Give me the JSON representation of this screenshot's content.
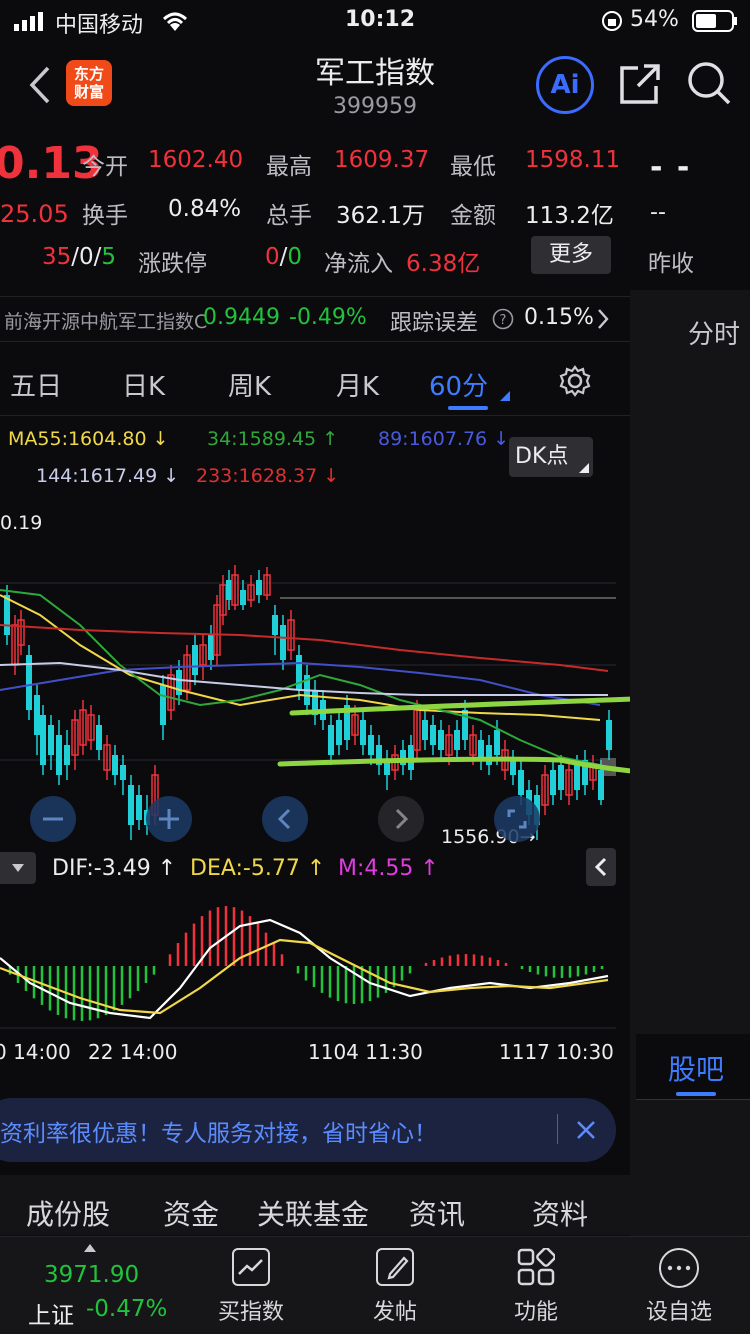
{
  "status_bar": {
    "carrier": "中国移动",
    "time": "10:12",
    "battery": "54%"
  },
  "header": {
    "title": "军工指数",
    "code": "399959",
    "logo_text": "东方\n财富",
    "ai_label": "Ai"
  },
  "quote": {
    "price": "0.13",
    "change": "25.05",
    "open_label": "今开",
    "open": "1602.40",
    "high_label": "最高",
    "high": "1609.37",
    "low_label": "最低",
    "low": "1598.11",
    "dash_1": "- -",
    "turnover_label": "换手",
    "turnover": "0.84%",
    "volume_label": "总手",
    "volume": "362.1万",
    "amount_label": "金额",
    "amount": "113.2亿",
    "dash_2": "--",
    "updown_up": "35",
    "updown_sep1": "/",
    "updown_flat": "0",
    "updown_sep2": "/",
    "updown_down": "5",
    "limit_label": "涨跌停",
    "limit_up": "0",
    "limit_sep": "/",
    "limit_down": "0",
    "netflow_label": "净流入",
    "netflow": "6.38亿",
    "more_label": "更多",
    "prev_close_label": "昨收"
  },
  "fund_bar": {
    "name": "前海开源中航军工指数C",
    "price": "0.9449",
    "change": "-0.49%",
    "tracking_label": "跟踪误差",
    "tracking_value": "0.15%"
  },
  "right_panel": {
    "intraday_tab": "分时",
    "guba_tab": "股吧"
  },
  "period_tabs": [
    {
      "label": "五日",
      "active": false
    },
    {
      "label": "日K",
      "active": false
    },
    {
      "label": "周K",
      "active": false
    },
    {
      "label": "月K",
      "active": false
    },
    {
      "label": "60分",
      "active": true
    }
  ],
  "ma": {
    "ma55": "MA55:1604.80 ↓",
    "ma34": "34:1589.45 ↑",
    "ma89": "89:1607.76 ↓",
    "ma144": "144:1617.49 ↓",
    "ma233": "233:1628.37 ↓",
    "dk_label": "DK点"
  },
  "chart": {
    "top_price_label": "0.19",
    "low_marker": "1556.90→",
    "colors": {
      "up": "#f0323c",
      "down": "#1fd0d8",
      "ma55": "#f0d84a",
      "ma34": "#2ea83a",
      "ma89": "#4150c8",
      "ma144": "#c8cce8",
      "ma233": "#c82a2a",
      "annotation": "#8ed641"
    }
  },
  "macd": {
    "dif": "DIF:-3.49 ↑",
    "dea": "DEA:-5.77 ↑",
    "m": "M:4.55 ↑"
  },
  "time_axis": [
    "0 14:00",
    "22 14:00",
    "1104 11:30",
    "1117 10:30"
  ],
  "ad_banner": {
    "text": "资利率很优惠！专人服务对接，省时省心！"
  },
  "bottom_tabs": [
    "成份股",
    "资金",
    "关联基金",
    "资讯",
    "资料"
  ],
  "bottom_nav": {
    "index_value": "3971.90",
    "index_name": "上证",
    "index_change": "-0.47%",
    "items": [
      {
        "label": "买指数",
        "icon": "chart-icon"
      },
      {
        "label": "发帖",
        "icon": "edit-icon"
      },
      {
        "label": "功能",
        "icon": "grid-icon"
      },
      {
        "label": "设自选",
        "icon": "more-icon"
      }
    ]
  }
}
